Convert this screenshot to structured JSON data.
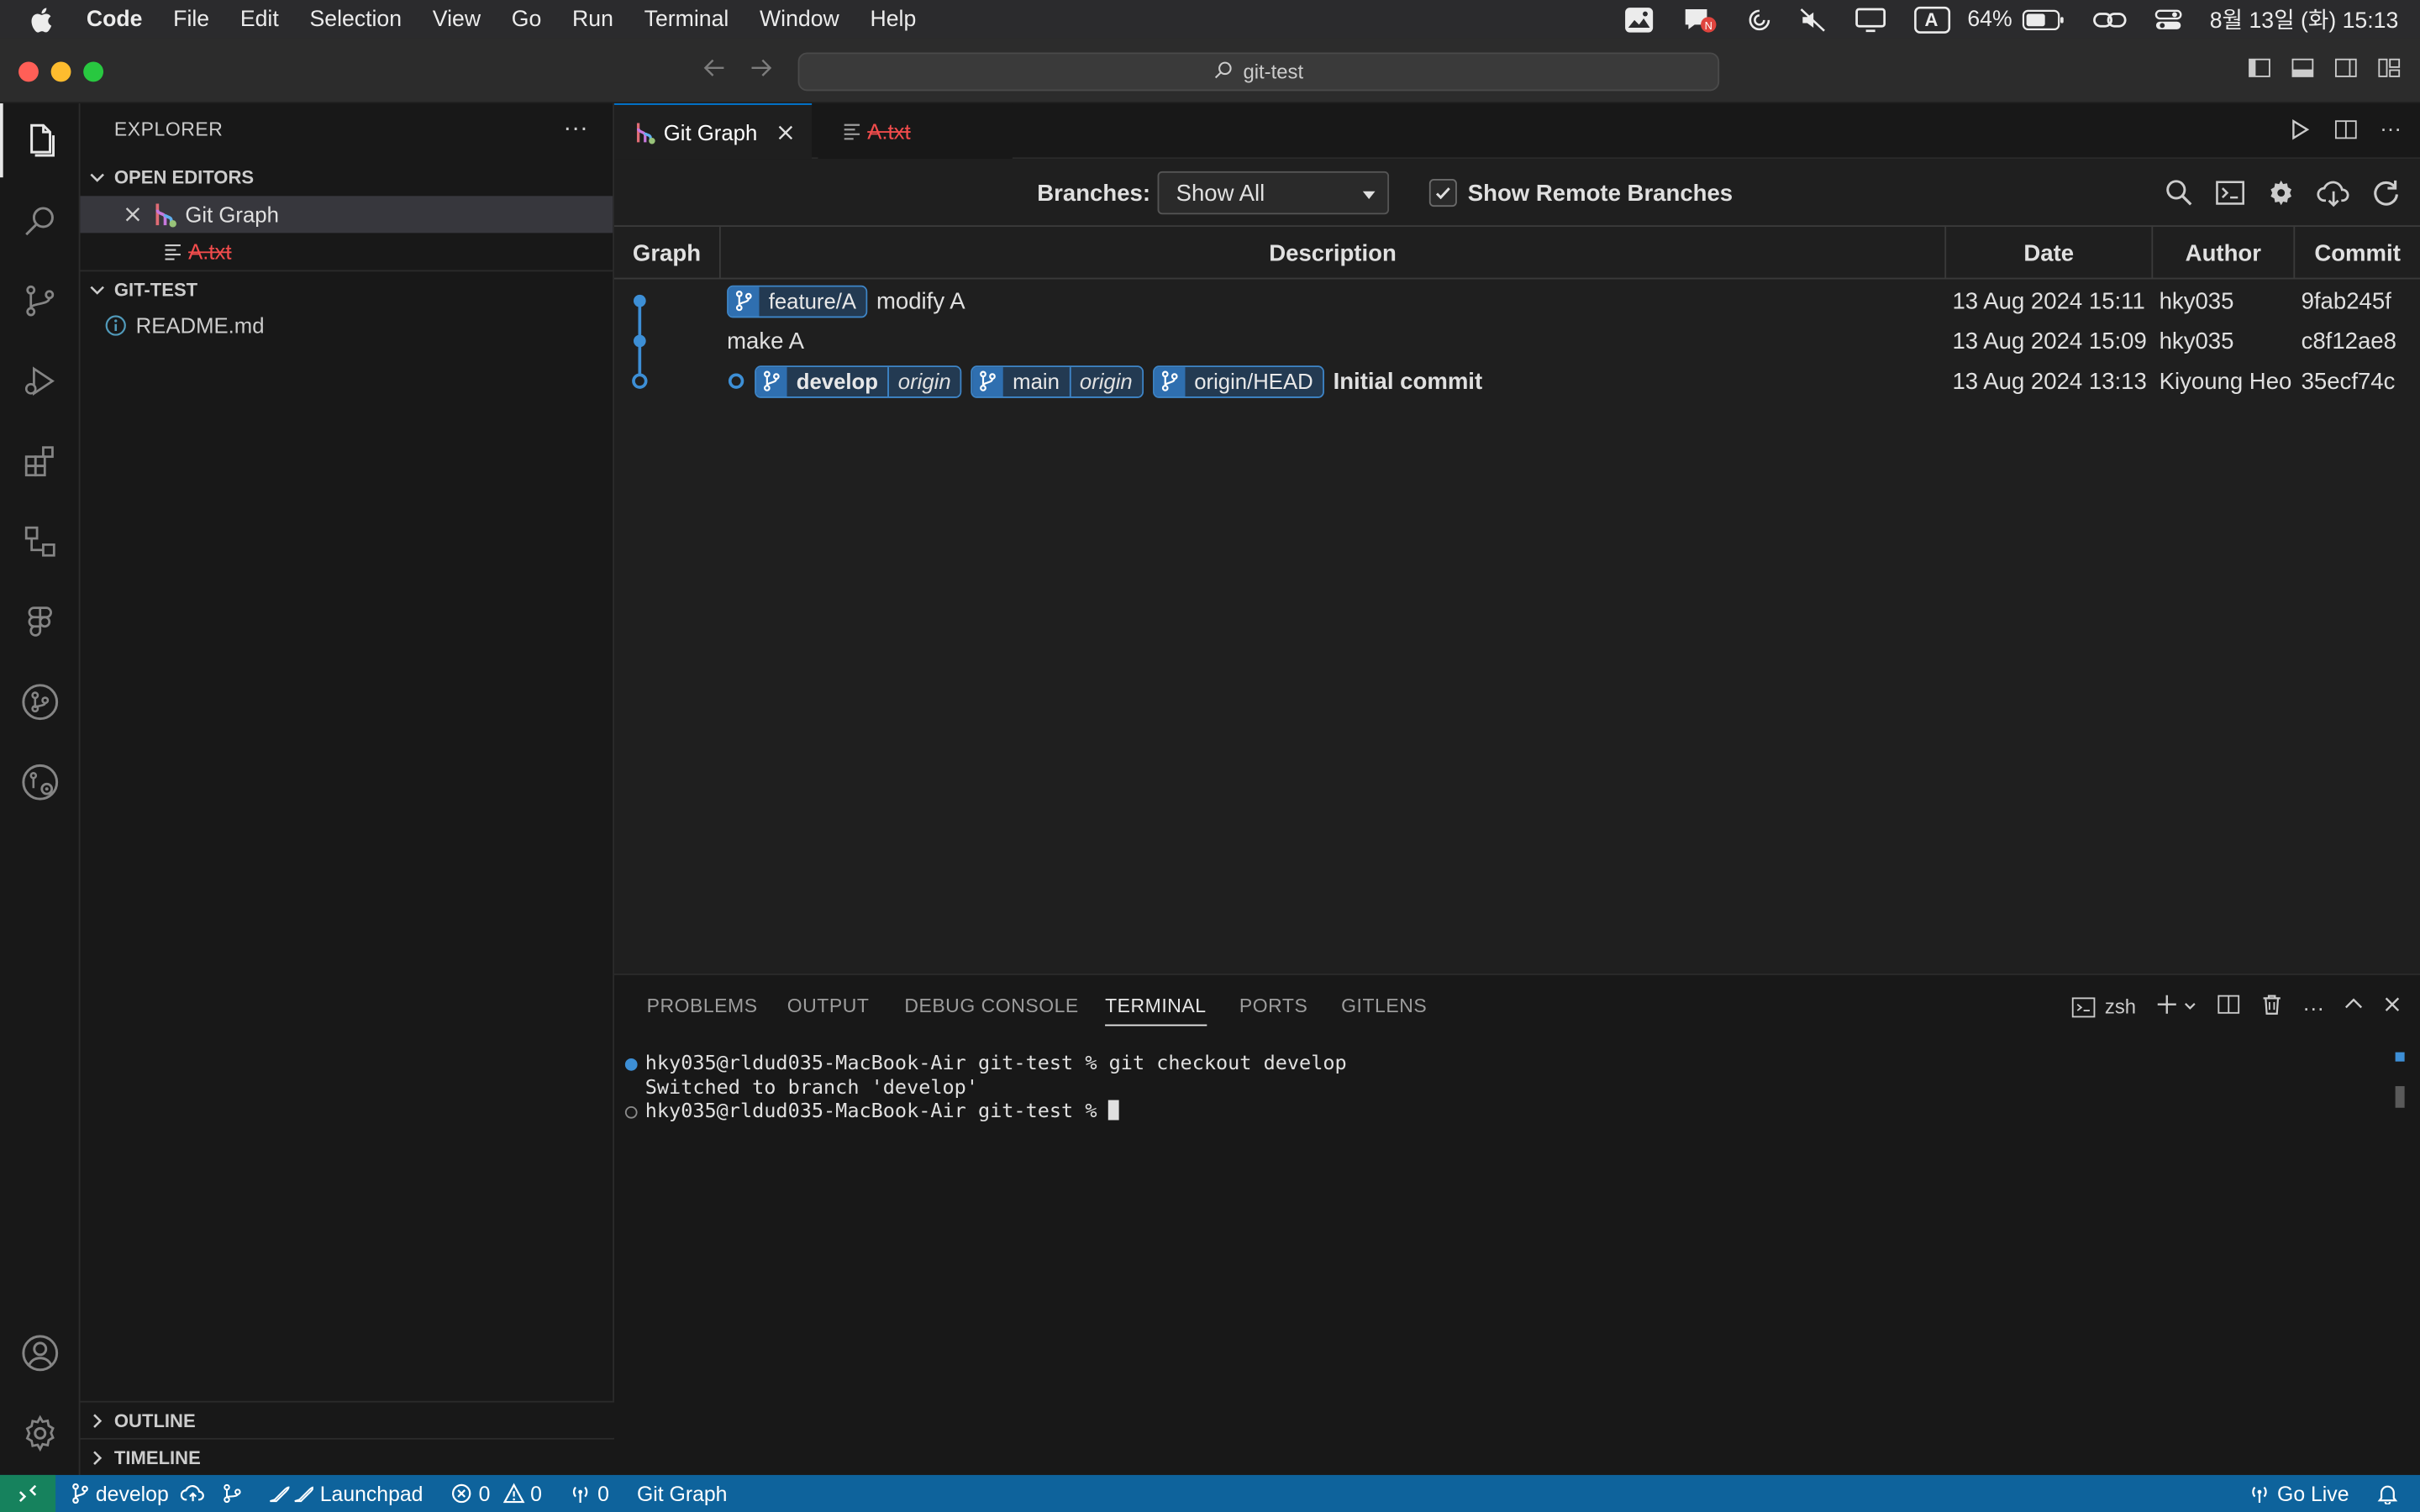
{
  "menubar": {
    "app_name": "Code",
    "items": [
      "File",
      "Edit",
      "Selection",
      "View",
      "Go",
      "Run",
      "Terminal",
      "Window",
      "Help"
    ],
    "battery": "64%",
    "datetime": "8월 13일 (화) 15:13",
    "input_indicator": "A"
  },
  "titlebar": {
    "search_text": "git-test"
  },
  "sidebar": {
    "title": "EXPLORER",
    "open_editors_label": "OPEN EDITORS",
    "open_editors": [
      {
        "label": "Git Graph"
      },
      {
        "label": "A.txt"
      }
    ],
    "folder_label": "GIT-TEST",
    "files": [
      {
        "label": "README.md"
      }
    ],
    "outline_label": "OUTLINE",
    "timeline_label": "TIMELINE"
  },
  "tabs": [
    {
      "label": "Git Graph",
      "active": true
    },
    {
      "label": "A.txt",
      "active": false
    }
  ],
  "gitgraph": {
    "branches_label": "Branches:",
    "branches_value": "Show All",
    "show_remote_label": "Show Remote Branches",
    "show_remote_checked": true,
    "columns": [
      "Graph",
      "Description",
      "Date",
      "Author",
      "Commit"
    ],
    "commits": [
      {
        "refs": [
          {
            "name": "feature/A",
            "remote": ""
          }
        ],
        "message": "modify A",
        "date": "13 Aug 2024 15:11",
        "author": "hky035",
        "hash": "9fab245f"
      },
      {
        "refs": [],
        "message": "make A",
        "date": "13 Aug 2024 15:09",
        "author": "hky035",
        "hash": "c8f12ae8"
      },
      {
        "refs": [
          {
            "name": "develop",
            "remote": "origin",
            "bold": true
          },
          {
            "name": "main",
            "remote": "origin"
          },
          {
            "name": "origin/HEAD",
            "remote": ""
          }
        ],
        "message": "Initial commit",
        "date": "13 Aug 2024 13:13",
        "author": "Kiyoung Heo",
        "hash": "35ecf74c"
      }
    ]
  },
  "panel": {
    "tabs": [
      "PROBLEMS",
      "OUTPUT",
      "DEBUG CONSOLE",
      "TERMINAL",
      "PORTS",
      "GITLENS"
    ],
    "active_tab": "TERMINAL",
    "shell": "zsh",
    "terminal_lines": [
      "hky035@rldud035-MacBook-Air git-test % git checkout develop",
      "Switched to branch 'develop'",
      "hky035@rldud035-MacBook-Air git-test % "
    ]
  },
  "statusbar": {
    "branch": "develop",
    "launchpad": "Launchpad",
    "errors": "0",
    "warnings": "0",
    "ports": "0",
    "gitgraph": "Git Graph",
    "golive": "Go Live"
  },
  "colors": {
    "accent": "#0078d4",
    "statusbar": "#0e639c",
    "graph_line": "#3d8fd6",
    "deleted_file": "#f14c4c"
  }
}
